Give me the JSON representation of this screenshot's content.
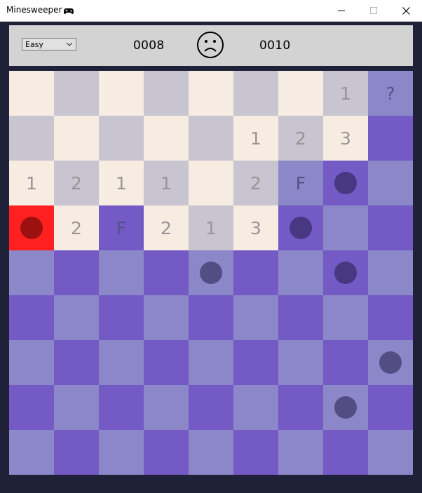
{
  "window": {
    "title": "Minesweeper",
    "title_icon": "gamepad-icon",
    "controls": {
      "minimize": "minimize-icon",
      "maximize": "maximize-icon",
      "close": "close-icon"
    }
  },
  "toolbar": {
    "difficulty": {
      "selected": "Easy"
    },
    "mine_counter": "0008",
    "face": "sad-face-icon",
    "timer": "0010"
  },
  "colors": {
    "revealed_light": "#f6ece2",
    "revealed_dark": "#c8c4d0",
    "hidden_light": "#8c87c9",
    "hidden_dark": "#735ac5",
    "exploded": "#ff2020",
    "background": "#1f2138",
    "toolbar": "#d3d3d3"
  },
  "board": {
    "rows": 9,
    "cols": 9,
    "cells": [
      [
        "",
        "",
        "",
        "",
        "",
        "",
        "",
        "1",
        "?"
      ],
      [
        "",
        "",
        "",
        "",
        "",
        "1",
        "2",
        "3",
        "#"
      ],
      [
        "1",
        "2",
        "1",
        "1",
        "",
        "2",
        "F",
        "*",
        "#"
      ],
      [
        "X",
        "2",
        "F",
        "2",
        "1",
        "3",
        "*",
        "#",
        "#"
      ],
      [
        "#",
        "#",
        "#",
        "#",
        "*",
        "#",
        "#",
        "*",
        "#"
      ],
      [
        "#",
        "#",
        "#",
        "#",
        "#",
        "#",
        "#",
        "#",
        "#"
      ],
      [
        "#",
        "#",
        "#",
        "#",
        "#",
        "#",
        "#",
        "#",
        "*"
      ],
      [
        "#",
        "#",
        "#",
        "#",
        "#",
        "#",
        "#",
        "*",
        "#"
      ],
      [
        "#",
        "#",
        "#",
        "#",
        "#",
        "#",
        "#",
        "#",
        "#"
      ]
    ]
  }
}
